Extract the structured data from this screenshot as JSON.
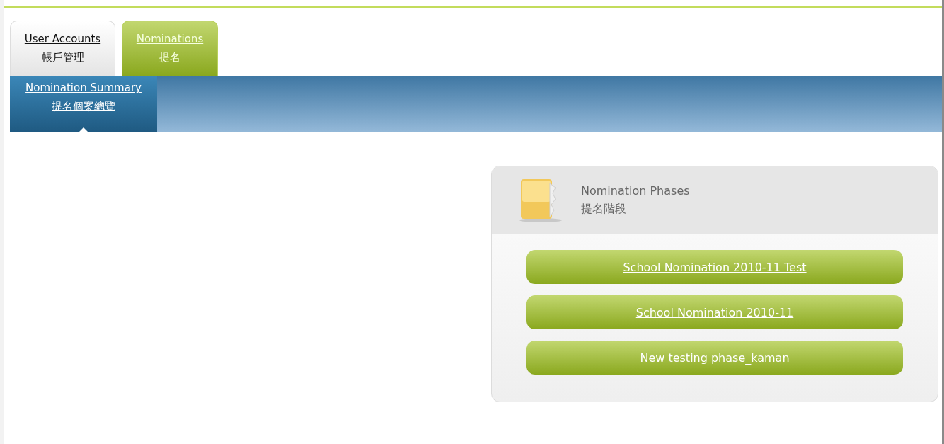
{
  "tabs": [
    {
      "label": "User Accounts",
      "label_zh": "帳戶管理",
      "selected": false
    },
    {
      "label": "Nominations",
      "label_zh": "提名",
      "selected": true
    }
  ],
  "subnav": [
    {
      "label": "Nomination Summary",
      "label_zh": "提名個案總覽",
      "selected": true
    }
  ],
  "panel": {
    "title": "Nomination Phases",
    "title_zh": "提名階段",
    "phases": [
      "School Nomination 2010-11 Test",
      "School Nomination 2010-11",
      "New testing phase_kaman"
    ]
  }
}
